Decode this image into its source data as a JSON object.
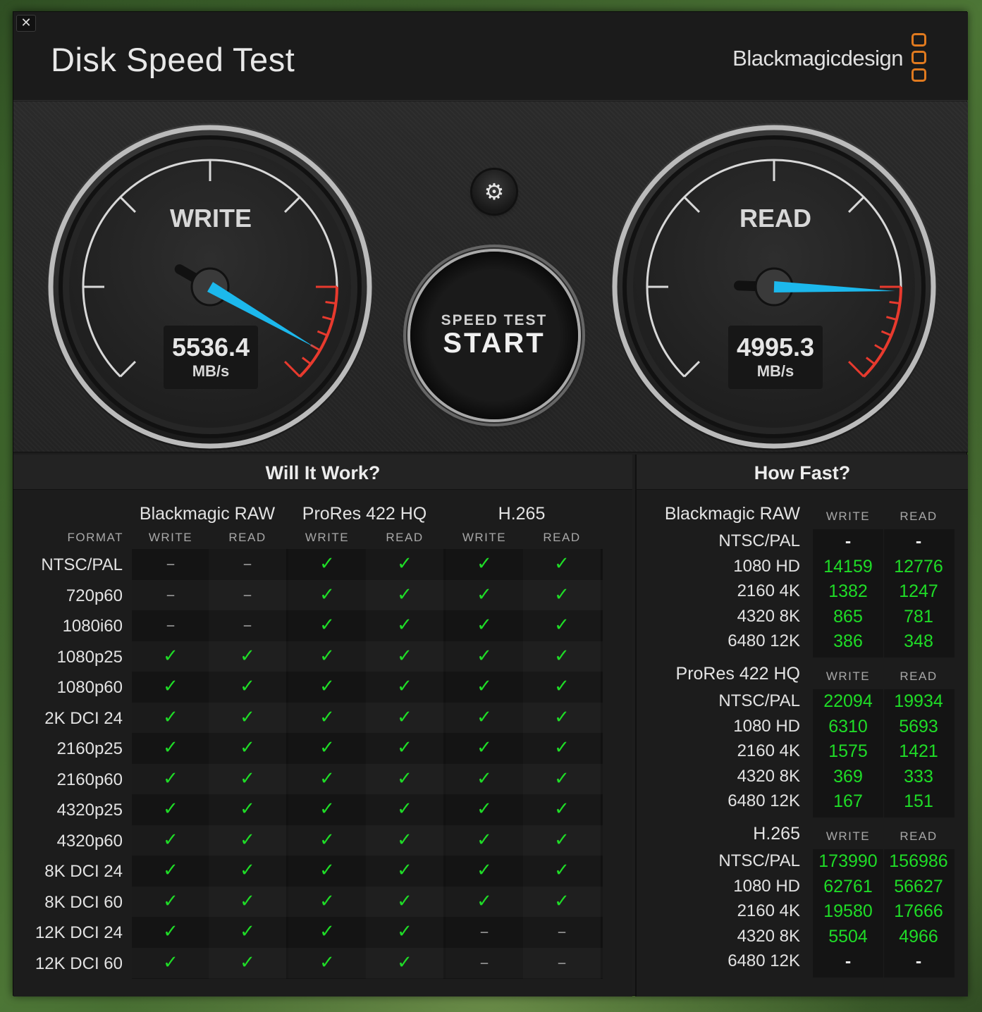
{
  "window": {
    "close_label": "✕"
  },
  "header": {
    "title": "Disk Speed Test",
    "brand": "Blackmagicdesign",
    "brand_color": "#e07a1f"
  },
  "gauges": {
    "write": {
      "label": "WRITE",
      "value": "5536.4",
      "unit": "MB/s"
    },
    "read": {
      "label": "READ",
      "value": "4995.3",
      "unit": "MB/s"
    },
    "needle_color": "#1cb8ec",
    "danger_color": "#e83a2e"
  },
  "controls": {
    "settings_icon": "gear-icon",
    "start_sub": "SPEED TEST",
    "start_main": "START"
  },
  "will_it_work": {
    "title": "Will It Work?",
    "format_header": "FORMAT",
    "write_header": "WRITE",
    "read_header": "READ",
    "codecs": [
      "Blackmagic RAW",
      "ProRes 422 HQ",
      "H.265"
    ],
    "rows": [
      {
        "format": "NTSC/PAL",
        "cells": [
          "–",
          "–",
          "✓",
          "✓",
          "✓",
          "✓"
        ]
      },
      {
        "format": "720p60",
        "cells": [
          "–",
          "–",
          "✓",
          "✓",
          "✓",
          "✓"
        ]
      },
      {
        "format": "1080i60",
        "cells": [
          "–",
          "–",
          "✓",
          "✓",
          "✓",
          "✓"
        ]
      },
      {
        "format": "1080p25",
        "cells": [
          "✓",
          "✓",
          "✓",
          "✓",
          "✓",
          "✓"
        ]
      },
      {
        "format": "1080p60",
        "cells": [
          "✓",
          "✓",
          "✓",
          "✓",
          "✓",
          "✓"
        ]
      },
      {
        "format": "2K DCI 24",
        "cells": [
          "✓",
          "✓",
          "✓",
          "✓",
          "✓",
          "✓"
        ]
      },
      {
        "format": "2160p25",
        "cells": [
          "✓",
          "✓",
          "✓",
          "✓",
          "✓",
          "✓"
        ]
      },
      {
        "format": "2160p60",
        "cells": [
          "✓",
          "✓",
          "✓",
          "✓",
          "✓",
          "✓"
        ]
      },
      {
        "format": "4320p25",
        "cells": [
          "✓",
          "✓",
          "✓",
          "✓",
          "✓",
          "✓"
        ]
      },
      {
        "format": "4320p60",
        "cells": [
          "✓",
          "✓",
          "✓",
          "✓",
          "✓",
          "✓"
        ]
      },
      {
        "format": "8K DCI 24",
        "cells": [
          "✓",
          "✓",
          "✓",
          "✓",
          "✓",
          "✓"
        ]
      },
      {
        "format": "8K DCI 60",
        "cells": [
          "✓",
          "✓",
          "✓",
          "✓",
          "✓",
          "✓"
        ]
      },
      {
        "format": "12K DCI 24",
        "cells": [
          "✓",
          "✓",
          "✓",
          "✓",
          "–",
          "–"
        ]
      },
      {
        "format": "12K DCI 60",
        "cells": [
          "✓",
          "✓",
          "✓",
          "✓",
          "–",
          "–"
        ]
      }
    ],
    "ok_color": "#1fdc27"
  },
  "how_fast": {
    "title": "How Fast?",
    "write_header": "WRITE",
    "read_header": "READ",
    "groups": [
      {
        "codec": "Blackmagic RAW",
        "rows": [
          {
            "format": "NTSC/PAL",
            "write": "-",
            "read": "-"
          },
          {
            "format": "1080 HD",
            "write": "14159",
            "read": "12776"
          },
          {
            "format": "2160 4K",
            "write": "1382",
            "read": "1247"
          },
          {
            "format": "4320 8K",
            "write": "865",
            "read": "781"
          },
          {
            "format": "6480 12K",
            "write": "386",
            "read": "348"
          }
        ]
      },
      {
        "codec": "ProRes 422 HQ",
        "rows": [
          {
            "format": "NTSC/PAL",
            "write": "22094",
            "read": "19934"
          },
          {
            "format": "1080 HD",
            "write": "6310",
            "read": "5693"
          },
          {
            "format": "2160 4K",
            "write": "1575",
            "read": "1421"
          },
          {
            "format": "4320 8K",
            "write": "369",
            "read": "333"
          },
          {
            "format": "6480 12K",
            "write": "167",
            "read": "151"
          }
        ]
      },
      {
        "codec": "H.265",
        "rows": [
          {
            "format": "NTSC/PAL",
            "write": "173990",
            "read": "156986"
          },
          {
            "format": "1080 HD",
            "write": "62761",
            "read": "56627"
          },
          {
            "format": "2160 4K",
            "write": "19580",
            "read": "17666"
          },
          {
            "format": "4320 8K",
            "write": "5504",
            "read": "4966"
          },
          {
            "format": "6480 12K",
            "write": "-",
            "read": "-"
          }
        ]
      }
    ]
  }
}
